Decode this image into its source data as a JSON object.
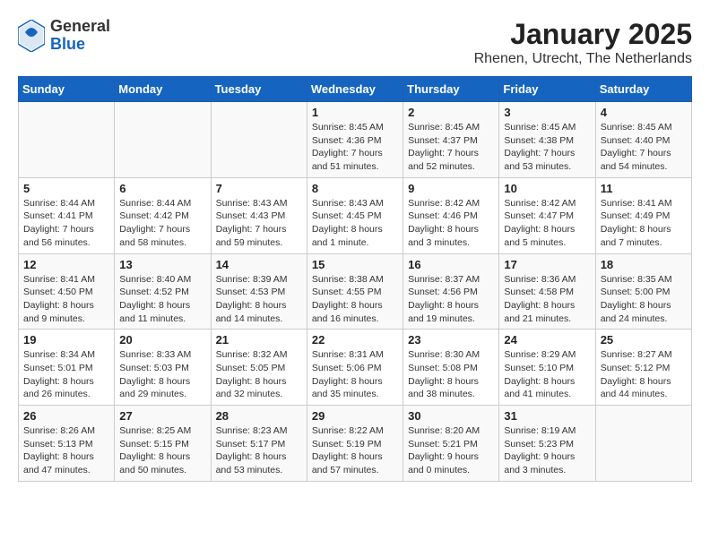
{
  "header": {
    "logo_general": "General",
    "logo_blue": "Blue",
    "title": "January 2025",
    "subtitle": "Rhenen, Utrecht, The Netherlands"
  },
  "weekdays": [
    "Sunday",
    "Monday",
    "Tuesday",
    "Wednesday",
    "Thursday",
    "Friday",
    "Saturday"
  ],
  "weeks": [
    [
      {
        "day": "",
        "info": ""
      },
      {
        "day": "",
        "info": ""
      },
      {
        "day": "",
        "info": ""
      },
      {
        "day": "1",
        "info": "Sunrise: 8:45 AM\nSunset: 4:36 PM\nDaylight: 7 hours\nand 51 minutes."
      },
      {
        "day": "2",
        "info": "Sunrise: 8:45 AM\nSunset: 4:37 PM\nDaylight: 7 hours\nand 52 minutes."
      },
      {
        "day": "3",
        "info": "Sunrise: 8:45 AM\nSunset: 4:38 PM\nDaylight: 7 hours\nand 53 minutes."
      },
      {
        "day": "4",
        "info": "Sunrise: 8:45 AM\nSunset: 4:40 PM\nDaylight: 7 hours\nand 54 minutes."
      }
    ],
    [
      {
        "day": "5",
        "info": "Sunrise: 8:44 AM\nSunset: 4:41 PM\nDaylight: 7 hours\nand 56 minutes."
      },
      {
        "day": "6",
        "info": "Sunrise: 8:44 AM\nSunset: 4:42 PM\nDaylight: 7 hours\nand 58 minutes."
      },
      {
        "day": "7",
        "info": "Sunrise: 8:43 AM\nSunset: 4:43 PM\nDaylight: 7 hours\nand 59 minutes."
      },
      {
        "day": "8",
        "info": "Sunrise: 8:43 AM\nSunset: 4:45 PM\nDaylight: 8 hours\nand 1 minute."
      },
      {
        "day": "9",
        "info": "Sunrise: 8:42 AM\nSunset: 4:46 PM\nDaylight: 8 hours\nand 3 minutes."
      },
      {
        "day": "10",
        "info": "Sunrise: 8:42 AM\nSunset: 4:47 PM\nDaylight: 8 hours\nand 5 minutes."
      },
      {
        "day": "11",
        "info": "Sunrise: 8:41 AM\nSunset: 4:49 PM\nDaylight: 8 hours\nand 7 minutes."
      }
    ],
    [
      {
        "day": "12",
        "info": "Sunrise: 8:41 AM\nSunset: 4:50 PM\nDaylight: 8 hours\nand 9 minutes."
      },
      {
        "day": "13",
        "info": "Sunrise: 8:40 AM\nSunset: 4:52 PM\nDaylight: 8 hours\nand 11 minutes."
      },
      {
        "day": "14",
        "info": "Sunrise: 8:39 AM\nSunset: 4:53 PM\nDaylight: 8 hours\nand 14 minutes."
      },
      {
        "day": "15",
        "info": "Sunrise: 8:38 AM\nSunset: 4:55 PM\nDaylight: 8 hours\nand 16 minutes."
      },
      {
        "day": "16",
        "info": "Sunrise: 8:37 AM\nSunset: 4:56 PM\nDaylight: 8 hours\nand 19 minutes."
      },
      {
        "day": "17",
        "info": "Sunrise: 8:36 AM\nSunset: 4:58 PM\nDaylight: 8 hours\nand 21 minutes."
      },
      {
        "day": "18",
        "info": "Sunrise: 8:35 AM\nSunset: 5:00 PM\nDaylight: 8 hours\nand 24 minutes."
      }
    ],
    [
      {
        "day": "19",
        "info": "Sunrise: 8:34 AM\nSunset: 5:01 PM\nDaylight: 8 hours\nand 26 minutes."
      },
      {
        "day": "20",
        "info": "Sunrise: 8:33 AM\nSunset: 5:03 PM\nDaylight: 8 hours\nand 29 minutes."
      },
      {
        "day": "21",
        "info": "Sunrise: 8:32 AM\nSunset: 5:05 PM\nDaylight: 8 hours\nand 32 minutes."
      },
      {
        "day": "22",
        "info": "Sunrise: 8:31 AM\nSunset: 5:06 PM\nDaylight: 8 hours\nand 35 minutes."
      },
      {
        "day": "23",
        "info": "Sunrise: 8:30 AM\nSunset: 5:08 PM\nDaylight: 8 hours\nand 38 minutes."
      },
      {
        "day": "24",
        "info": "Sunrise: 8:29 AM\nSunset: 5:10 PM\nDaylight: 8 hours\nand 41 minutes."
      },
      {
        "day": "25",
        "info": "Sunrise: 8:27 AM\nSunset: 5:12 PM\nDaylight: 8 hours\nand 44 minutes."
      }
    ],
    [
      {
        "day": "26",
        "info": "Sunrise: 8:26 AM\nSunset: 5:13 PM\nDaylight: 8 hours\nand 47 minutes."
      },
      {
        "day": "27",
        "info": "Sunrise: 8:25 AM\nSunset: 5:15 PM\nDaylight: 8 hours\nand 50 minutes."
      },
      {
        "day": "28",
        "info": "Sunrise: 8:23 AM\nSunset: 5:17 PM\nDaylight: 8 hours\nand 53 minutes."
      },
      {
        "day": "29",
        "info": "Sunrise: 8:22 AM\nSunset: 5:19 PM\nDaylight: 8 hours\nand 57 minutes."
      },
      {
        "day": "30",
        "info": "Sunrise: 8:20 AM\nSunset: 5:21 PM\nDaylight: 9 hours\nand 0 minutes."
      },
      {
        "day": "31",
        "info": "Sunrise: 8:19 AM\nSunset: 5:23 PM\nDaylight: 9 hours\nand 3 minutes."
      },
      {
        "day": "",
        "info": ""
      }
    ]
  ]
}
